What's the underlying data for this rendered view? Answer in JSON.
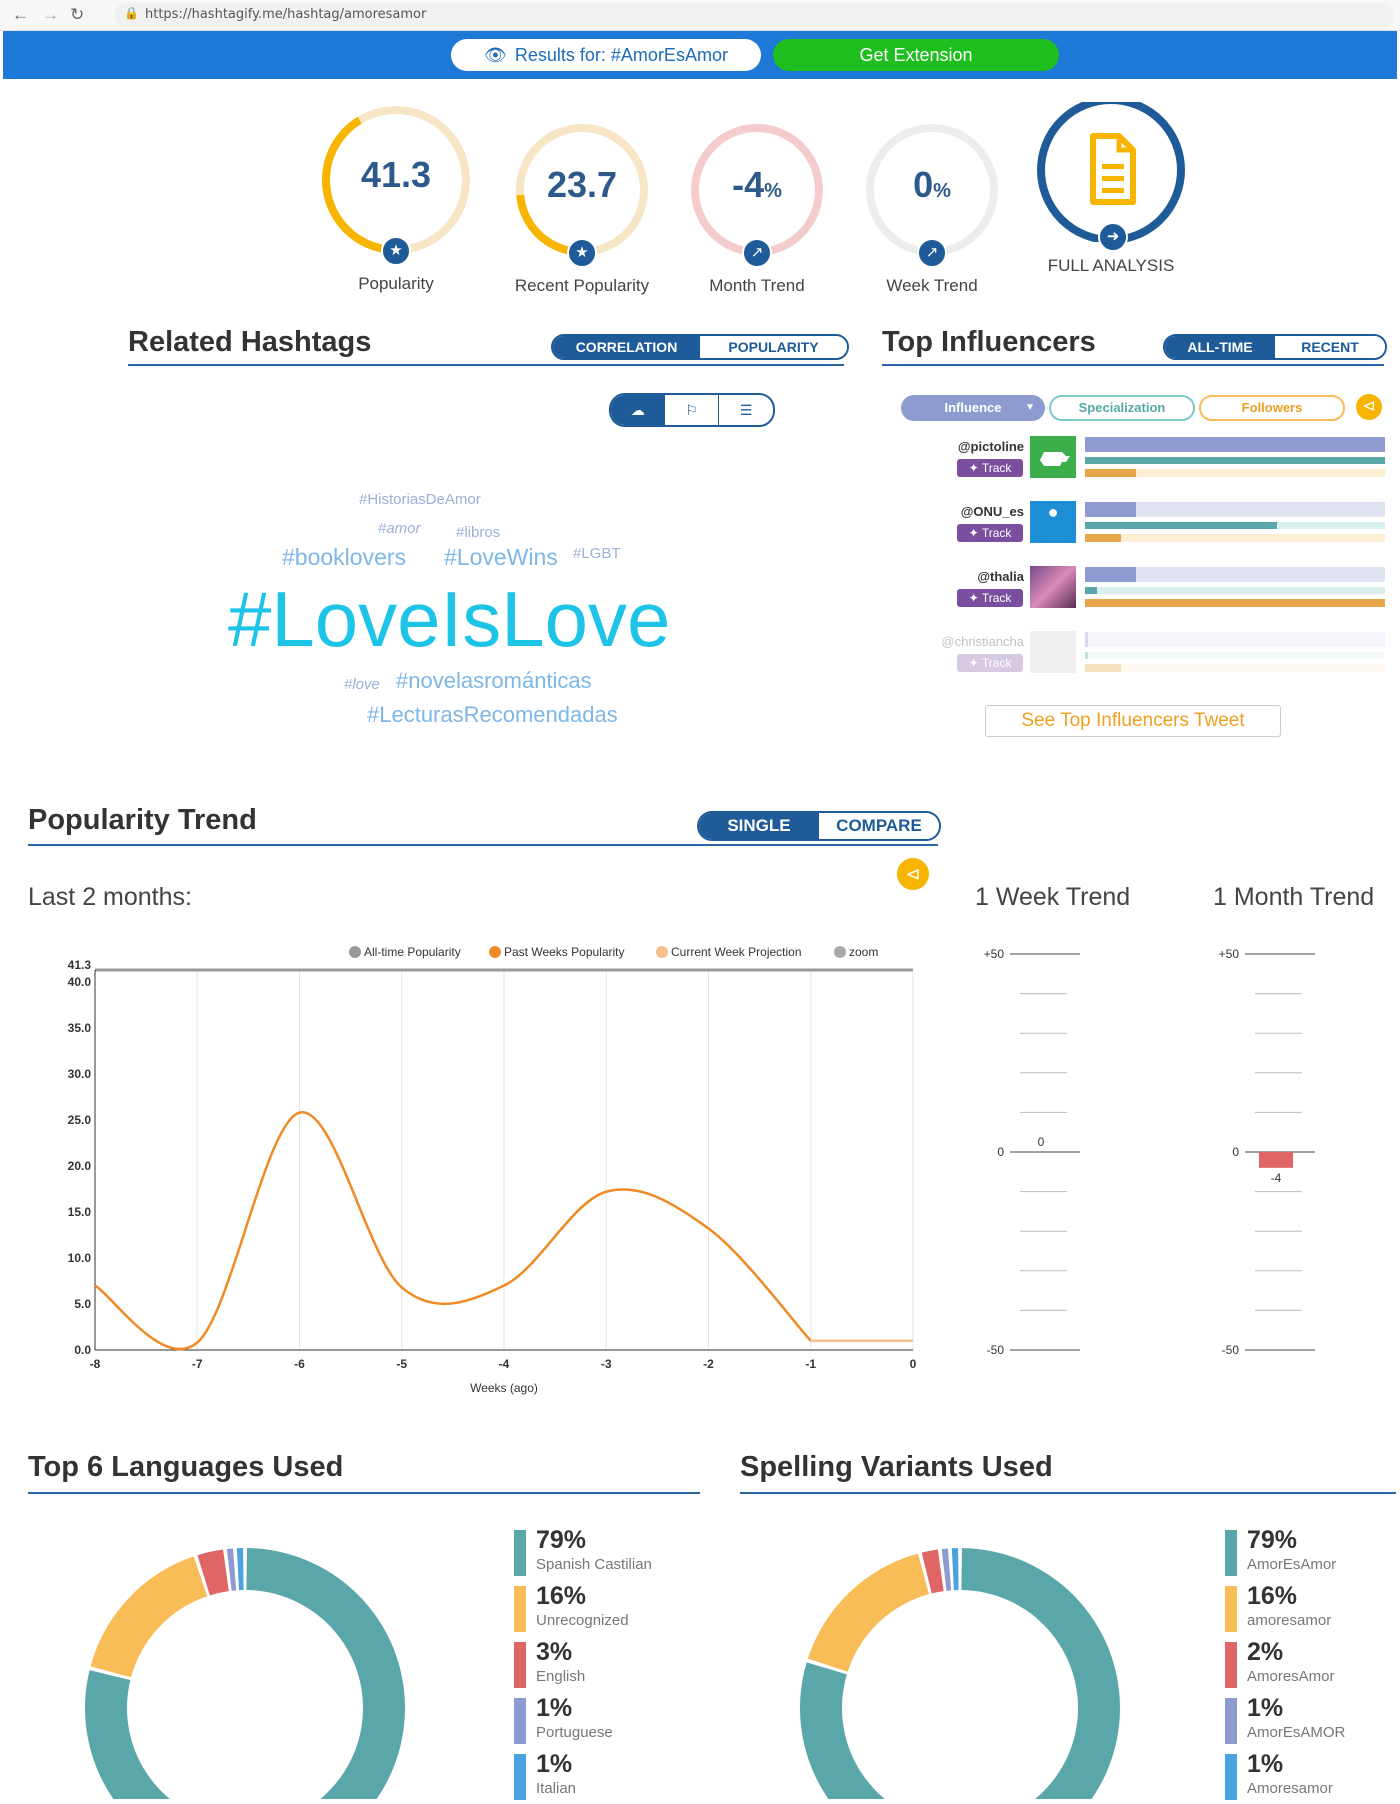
{
  "browser": {
    "url": "https://hashtagify.me/hashtag/amoresamor"
  },
  "topbar": {
    "results": "Results for: #AmorEsAmor",
    "get_extension": "Get Extension"
  },
  "gauges": [
    {
      "value": "41.3",
      "unit": "",
      "label": "Popularity",
      "fraction": 0.413,
      "color": "#f7b500",
      "icon": "star-icon"
    },
    {
      "value": "23.7",
      "unit": "",
      "label": "Recent Popularity",
      "fraction": 0.237,
      "color": "#f7b500",
      "icon": "star-icon"
    },
    {
      "value": "-4",
      "unit": "%",
      "label": "Month Trend",
      "fraction": 0,
      "color": "#e06666",
      "icon": "trend-icon"
    },
    {
      "value": "0",
      "unit": "%",
      "label": "Week Trend",
      "fraction": 0,
      "color": "#cccccc",
      "icon": "trend-icon"
    }
  ],
  "full_analysis": {
    "label": "FULL ANALYSIS"
  },
  "related": {
    "title": "Related Hashtags",
    "toggle": [
      "CORRELATION",
      "POPULARITY"
    ],
    "tags": [
      "#HistoriasDeAmor",
      "#amor",
      "#libros",
      "#booklovers",
      "#LoveWins",
      "#LGBT",
      "#LoveIsLove",
      "#love",
      "#novelasrománticas",
      "#LecturasRecomendadas"
    ]
  },
  "influencers": {
    "title": "Top Influencers",
    "toggle": [
      "ALL-TIME",
      "RECENT"
    ],
    "filters": [
      "Influence",
      "Specialization",
      "Followers"
    ],
    "track_label": "Track",
    "people": [
      {
        "name": "@pictoline",
        "influence": 1.0,
        "specialization": 1.0,
        "followers": 0.17
      },
      {
        "name": "@ONU_es",
        "influence": 0.17,
        "specialization": 0.64,
        "followers": 0.12
      },
      {
        "name": "@thalia",
        "influence": 0.17,
        "specialization": 0.04,
        "followers": 1.0
      },
      {
        "name": "@christiancha",
        "influence": 0.01,
        "specialization": 0.01,
        "followers": 0.12
      }
    ],
    "see_tweet": "See Top Influencers Tweet"
  },
  "trend": {
    "title": "Popularity Trend",
    "toggle": [
      "SINGLE",
      "COMPARE"
    ],
    "subtitle": "Last 2 months:",
    "week_title": "1 Week Trend",
    "month_title": "1 Month Trend"
  },
  "chart_data": [
    {
      "type": "line",
      "legend": [
        "All-time Popularity",
        "Past Weeks Popularity",
        "Current Week Projection",
        "zoom"
      ],
      "xlabel": "Weeks (ago)",
      "ylabel": "",
      "x": [
        -8,
        -7,
        -6,
        -5,
        -4,
        -3,
        -2,
        -1,
        0
      ],
      "xlim": [
        -8,
        0
      ],
      "ylim": [
        0,
        41.3
      ],
      "yticks": [
        "41.3",
        "40.0",
        "35.0",
        "30.0",
        "25.0",
        "20.0",
        "15.0",
        "10.0",
        "5.0",
        "0.0"
      ],
      "series": [
        {
          "name": "Past Weeks Popularity",
          "color": "#f08a24",
          "values": [
            7,
            0.8,
            25.8,
            6.8,
            7,
            17.2,
            13.2,
            1
          ]
        },
        {
          "name": "Current Week Projection",
          "color": "#f8c08c",
          "values": [
            null,
            null,
            null,
            null,
            null,
            null,
            null,
            1,
            1
          ]
        },
        {
          "name": "All-time Popularity",
          "color": "#aaaaaa",
          "values": [
            41.3,
            41.3,
            41.3,
            41.3,
            41.3,
            41.3,
            41.3,
            41.3,
            41.3
          ]
        }
      ]
    },
    {
      "type": "bar",
      "title": "1 Week Trend",
      "ylim": [
        -50,
        50
      ],
      "values": [
        0
      ],
      "labels": [
        "0"
      ],
      "ticks": [
        "+50",
        "0",
        "-50"
      ]
    },
    {
      "type": "bar",
      "title": "1 Month Trend",
      "ylim": [
        -50,
        50
      ],
      "values": [
        -4
      ],
      "labels": [
        "-4"
      ],
      "ticks": [
        "+50",
        "0",
        "-50"
      ]
    },
    {
      "type": "pie",
      "title": "Top 6 Languages Used",
      "slices": [
        {
          "pct": "79%",
          "name": "Spanish Castilian",
          "value": 79,
          "color": "#5aa7aa"
        },
        {
          "pct": "16%",
          "name": "Unrecognized",
          "value": 16,
          "color": "#f8bd56"
        },
        {
          "pct": "3%",
          "name": "English",
          "value": 3,
          "color": "#e06666"
        },
        {
          "pct": "1%",
          "name": "Portuguese",
          "value": 1,
          "color": "#8e9bd0"
        },
        {
          "pct": "1%",
          "name": "Italian",
          "value": 1,
          "color": "#4aa3df"
        }
      ]
    },
    {
      "type": "pie",
      "title": "Spelling Variants Used",
      "slices": [
        {
          "pct": "79%",
          "name": "AmorEsAmor",
          "value": 79,
          "color": "#5aa7aa"
        },
        {
          "pct": "16%",
          "name": "amoresamor",
          "value": 16,
          "color": "#f8bd56"
        },
        {
          "pct": "2%",
          "name": "AmoresAmor",
          "value": 2,
          "color": "#e06666"
        },
        {
          "pct": "1%",
          "name": "AmorEsAMOR",
          "value": 1,
          "color": "#8e9bd0"
        },
        {
          "pct": "1%",
          "name": "Amoresamor",
          "value": 1,
          "color": "#4aa3df"
        }
      ]
    }
  ],
  "languages_title": "Top 6 Languages Used",
  "variants_title": "Spelling Variants Used"
}
